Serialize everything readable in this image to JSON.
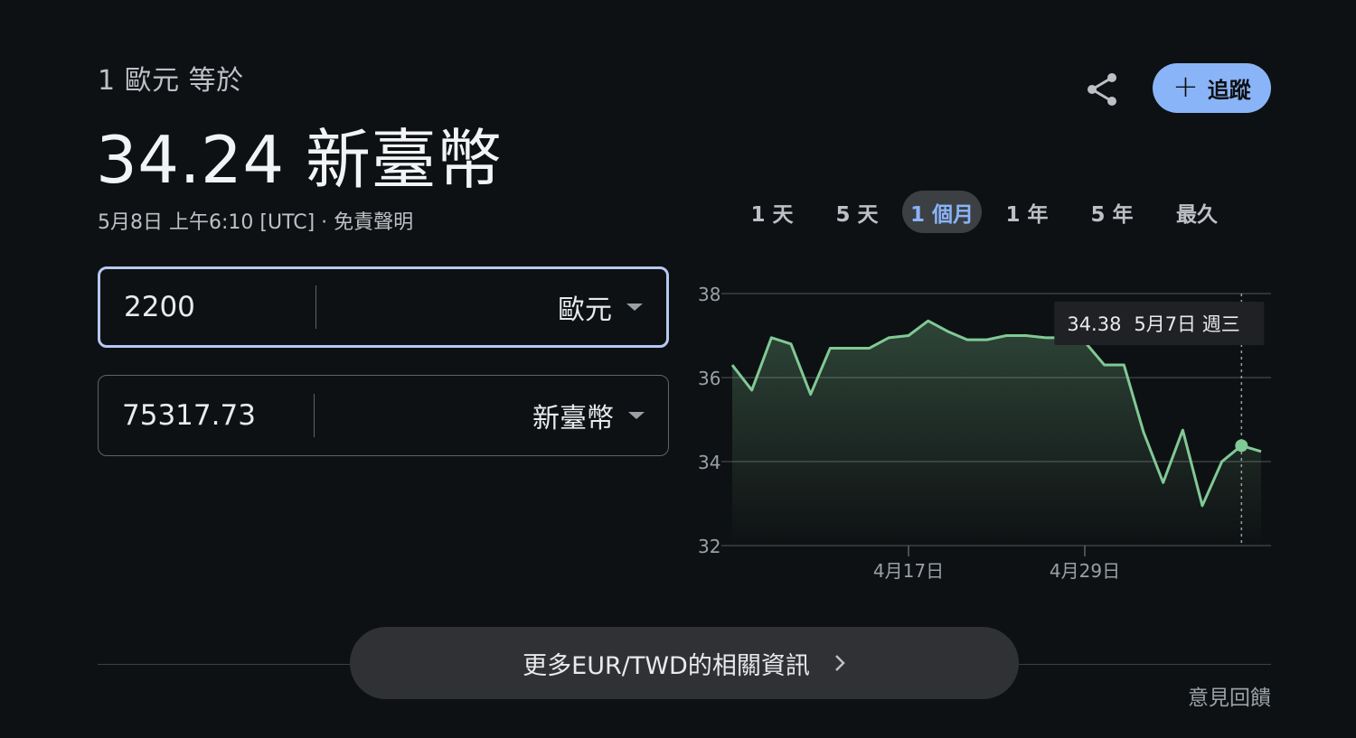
{
  "header": {
    "subtitle": "1 歐元 等於",
    "rate": "34.24 新臺幣",
    "timestamp": "5月8日 上午6:10 [UTC]",
    "separator": " · ",
    "disclaimer": "免責聲明",
    "follow_label": "追蹤"
  },
  "converter": {
    "from": {
      "amount": "2200",
      "currency": "歐元"
    },
    "to": {
      "amount": "75317.73",
      "currency": "新臺幣"
    }
  },
  "ranges": [
    {
      "label": "1 天"
    },
    {
      "label": "5 天"
    },
    {
      "label": "1 個月",
      "selected": true
    },
    {
      "label": "1 年"
    },
    {
      "label": "5 年"
    },
    {
      "label": "最久"
    }
  ],
  "chart_data": {
    "type": "area",
    "ylim": [
      32,
      38
    ],
    "yticks": [
      "38",
      "36",
      "34",
      "32"
    ],
    "x_tick_labels": [
      {
        "label": "4月17日",
        "index": 9
      },
      {
        "label": "4月29日",
        "index": 18
      }
    ],
    "values": [
      36.3,
      35.7,
      36.95,
      36.8,
      35.6,
      36.7,
      36.7,
      36.7,
      36.95,
      37.0,
      37.35,
      37.1,
      36.9,
      36.9,
      37.0,
      37.0,
      36.95,
      36.95,
      36.85,
      36.3,
      36.3,
      34.7,
      33.5,
      34.75,
      32.95,
      34.0,
      34.38,
      34.24
    ],
    "highlight_index": 26,
    "tooltip": {
      "value": "34.38",
      "date": "5月7日 週三"
    },
    "grid": true,
    "line_color": "#81c995"
  },
  "footer": {
    "more_label": "更多EUR/TWD的相關資訊",
    "feedback": "意見回饋"
  }
}
